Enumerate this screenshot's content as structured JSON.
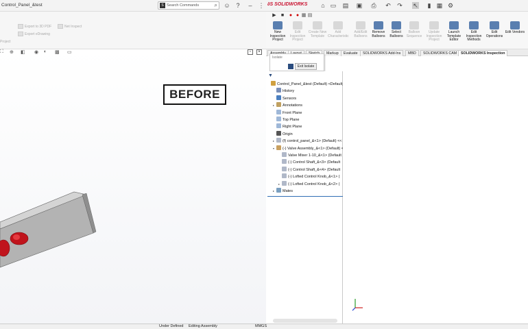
{
  "window": {
    "doc_title": "Control_Panel_&test",
    "search_placeholder": "Search Commands",
    "logo_text": "SOLIDWORKS"
  },
  "left_ribbon": {
    "items": [
      "Export to 3D PDF",
      "Export eDrawing",
      "Net Inspect",
      "Project"
    ]
  },
  "command_manager": {
    "commands": [
      {
        "label": "New Inspection Project",
        "enabled": true
      },
      {
        "label": "Edit Inspection Project",
        "enabled": false
      },
      {
        "label": "Create New Template",
        "enabled": false
      },
      {
        "label": "Add Characteristic",
        "enabled": false
      },
      {
        "label": "Add/Edit Balloons",
        "enabled": false
      },
      {
        "label": "Remove Balloons",
        "enabled": true
      },
      {
        "label": "Select Balloons",
        "enabled": true
      },
      {
        "label": "Balloon Sequence",
        "enabled": false
      },
      {
        "label": "Update Inspection Project",
        "enabled": false
      },
      {
        "label": "Launch Template Editor",
        "enabled": true
      },
      {
        "label": "Edit Inspection Methods",
        "enabled": true
      },
      {
        "label": "Edit Operations",
        "enabled": true
      },
      {
        "label": "Edit Vendors",
        "enabled": true
      }
    ]
  },
  "tabs": [
    {
      "label": "Assembly",
      "active": false
    },
    {
      "label": "Layout",
      "active": false
    },
    {
      "label": "Sketch",
      "active": false
    },
    {
      "label": "Markup",
      "active": false
    },
    {
      "label": "Evaluate",
      "active": false
    },
    {
      "label": "SOLIDWORKS Add-Ins",
      "active": false
    },
    {
      "label": "MBD",
      "active": false
    },
    {
      "label": "SOLIDWORKS CAM",
      "active": false
    },
    {
      "label": "SOLIDWORKS Inspection",
      "active": true
    }
  ],
  "isolate": {
    "title": "Isolate",
    "exit_label": "Exit Isolate"
  },
  "graphics": {
    "before_label": "BEFORE"
  },
  "tree": [
    {
      "label": "Control_Panel_&test (Default) <Default_",
      "indent": 0,
      "icon": "assembly-icon",
      "expand": ""
    },
    {
      "label": "History",
      "indent": 1,
      "icon": "history-icon",
      "expand": ""
    },
    {
      "label": "Sensors",
      "indent": 1,
      "icon": "sensor-icon",
      "expand": ""
    },
    {
      "label": "Annotations",
      "indent": 1,
      "icon": "annotation-icon",
      "expand": "▸"
    },
    {
      "label": "Front Plane",
      "indent": 1,
      "icon": "plane-icon",
      "expand": ""
    },
    {
      "label": "Top Plane",
      "indent": 1,
      "icon": "plane-icon",
      "expand": ""
    },
    {
      "label": "Right Plane",
      "indent": 1,
      "icon": "plane-icon",
      "expand": ""
    },
    {
      "label": "Origin",
      "indent": 1,
      "icon": "origin-icon",
      "expand": ""
    },
    {
      "label": "(f) control_panel_&<1> (Default) <<",
      "indent": 1,
      "icon": "part-icon",
      "expand": "▸"
    },
    {
      "label": "(-) Valve Assembly_&<1> (Default) <",
      "indent": 1,
      "icon": "subassembly-icon",
      "expand": "▾"
    },
    {
      "label": "Valve Mixer 1-10_&<1> (Default",
      "indent": 2,
      "icon": "part-icon",
      "expand": ""
    },
    {
      "label": "(-) Control Shaft_&<3> (Default",
      "indent": 2,
      "icon": "part-icon",
      "expand": ""
    },
    {
      "label": "(-) Control Shaft_&<4> (Default",
      "indent": 2,
      "icon": "part-icon",
      "expand": ""
    },
    {
      "label": "(-) Lofted Control Knob_&<1> (",
      "indent": 2,
      "icon": "part-icon",
      "expand": ""
    },
    {
      "label": "(-) Lofted Control Knob_&<2> (",
      "indent": 2,
      "icon": "part-icon",
      "expand": "▸"
    },
    {
      "label": "Mates",
      "indent": 1,
      "icon": "mates-icon",
      "expand": "▸"
    }
  ],
  "status": {
    "state": "Under Defined",
    "mode": "Editing Assembly",
    "units": "MMGS"
  },
  "colors": {
    "accent": "#2f6db5",
    "logo": "#c8102e",
    "knob": "#c0141c",
    "panel": "#b9b9b9"
  }
}
